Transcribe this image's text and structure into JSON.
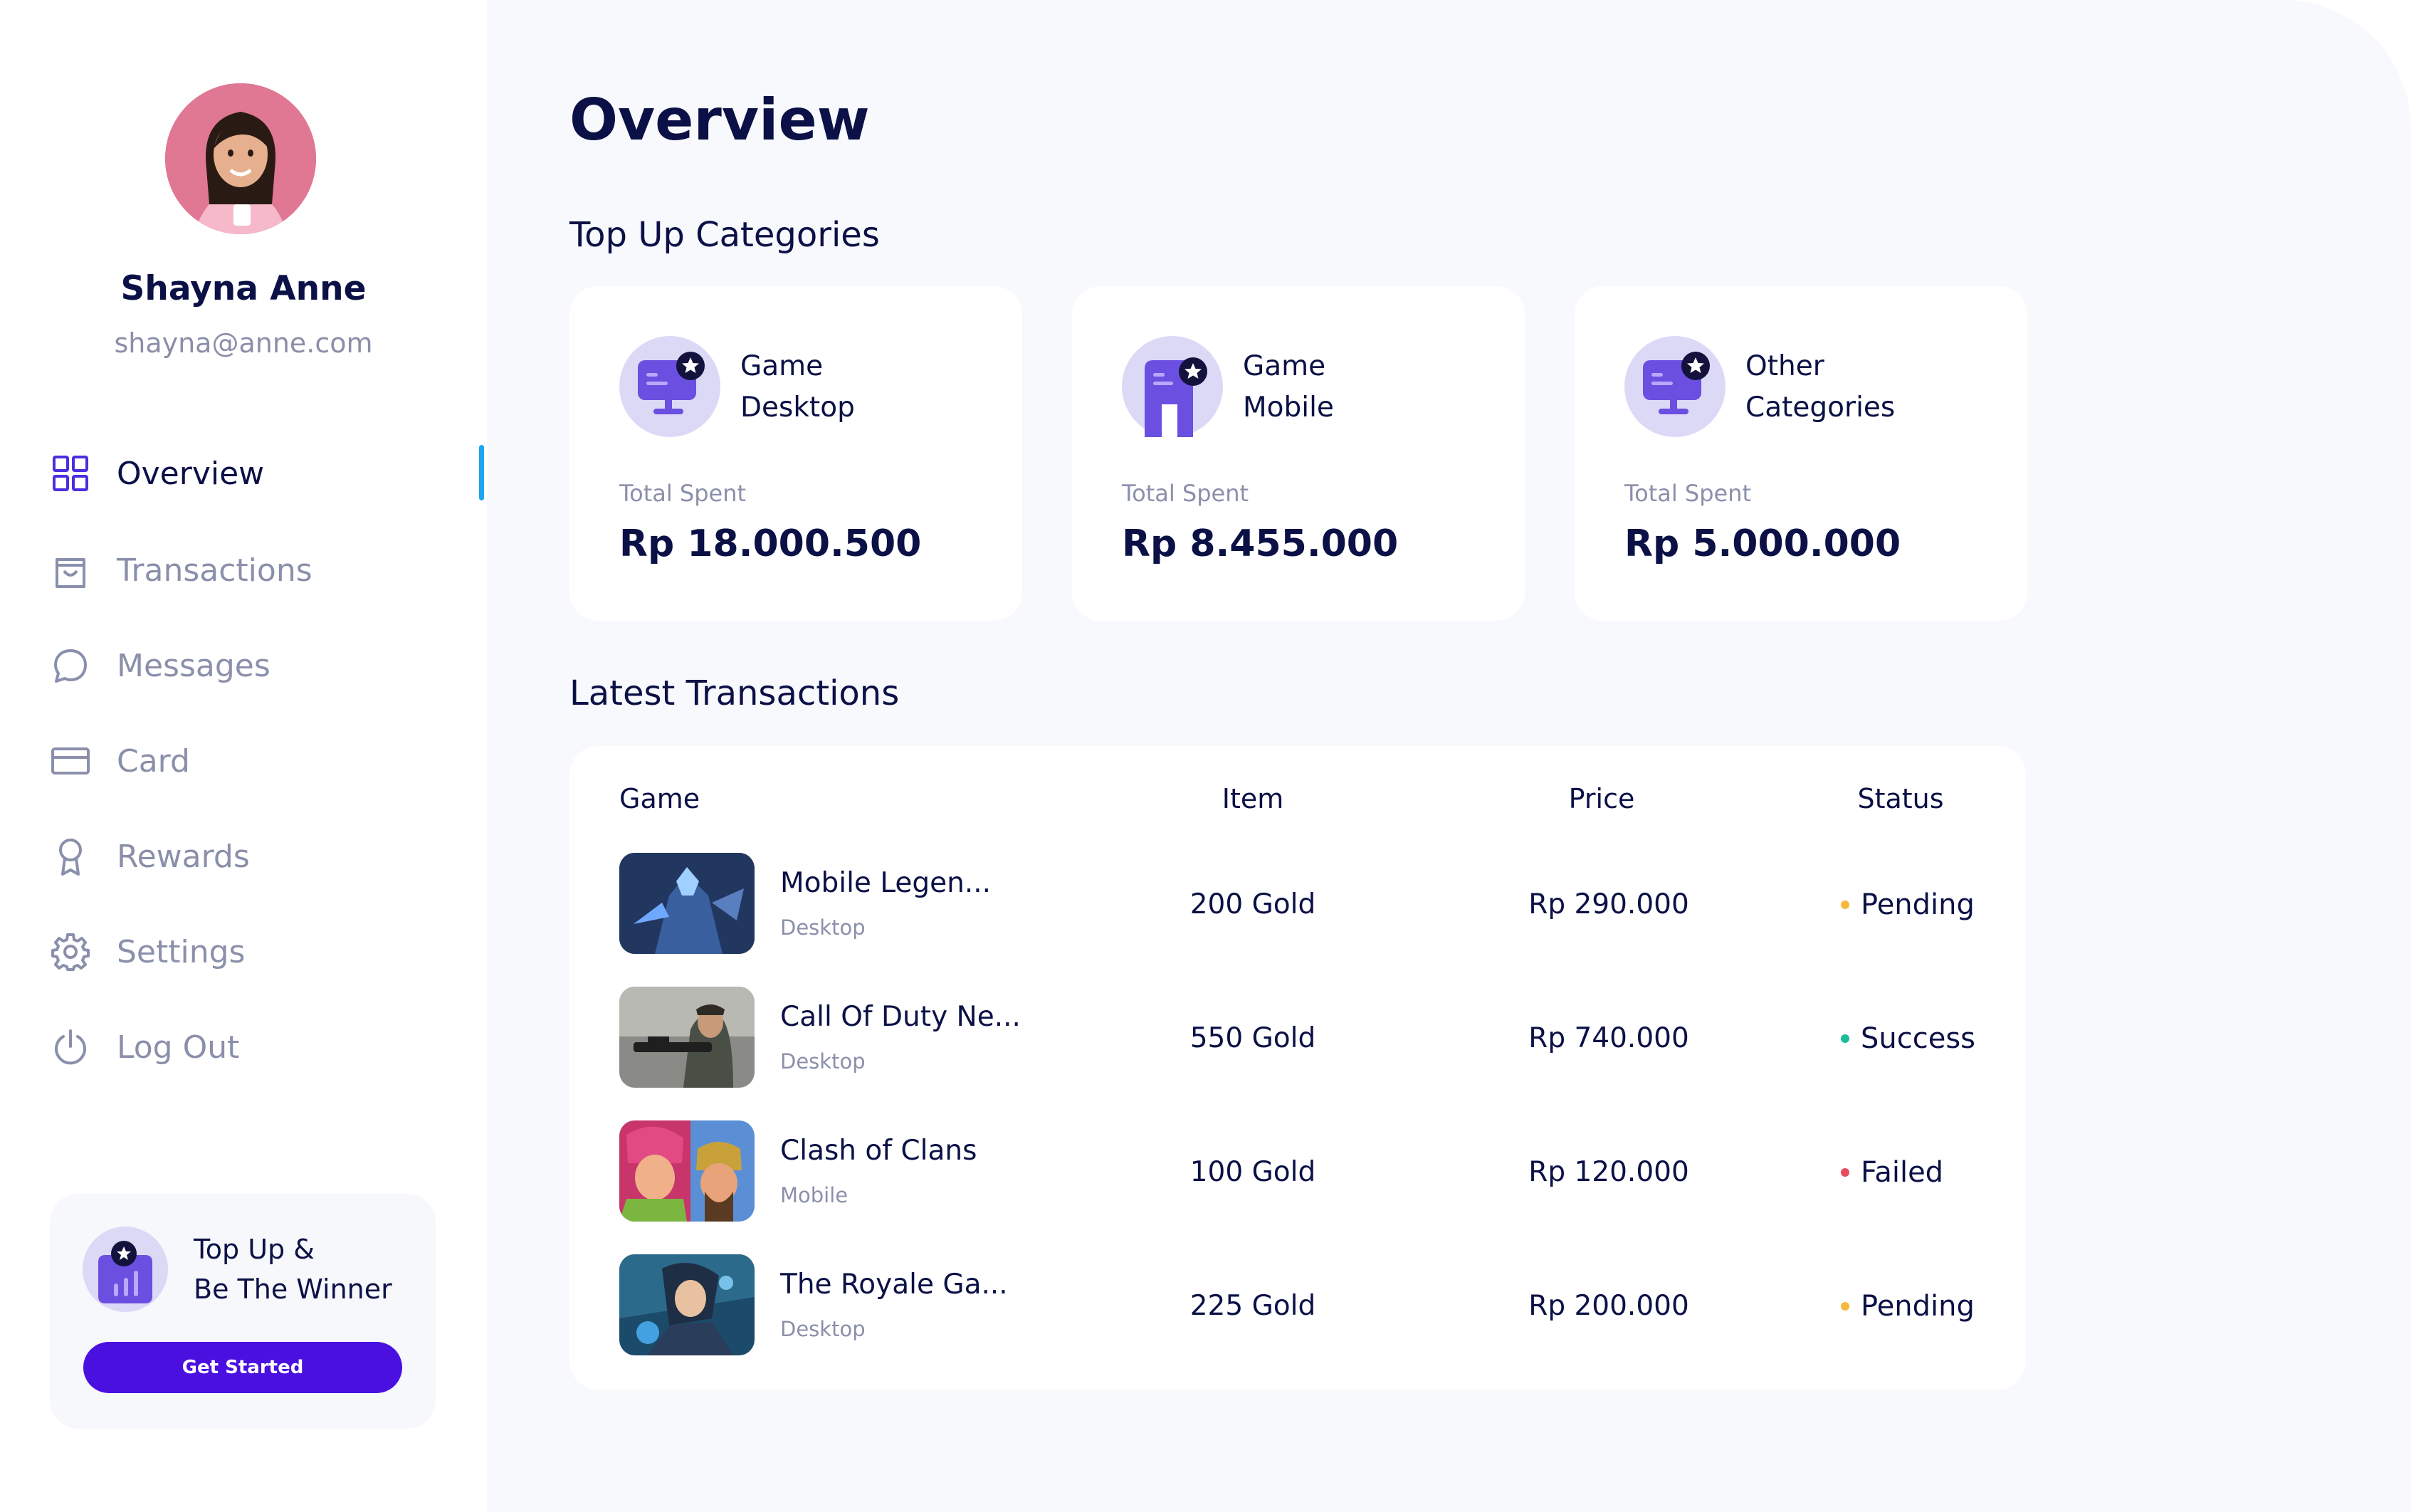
{
  "sidebar": {
    "user": {
      "name": "Shayna Anne",
      "email": "shayna@anne.com"
    },
    "nav": [
      {
        "label": "Overview",
        "icon": "grid-icon",
        "active": true
      },
      {
        "label": "Transactions",
        "icon": "shopping-bag-icon",
        "active": false
      },
      {
        "label": "Messages",
        "icon": "chat-bubble-icon",
        "active": false
      },
      {
        "label": "Card",
        "icon": "credit-card-icon",
        "active": false
      },
      {
        "label": "Rewards",
        "icon": "award-icon",
        "active": false
      },
      {
        "label": "Settings",
        "icon": "gear-icon",
        "active": false
      },
      {
        "label": "Log Out",
        "icon": "power-icon",
        "active": false
      }
    ],
    "promo": {
      "title": "Top Up &\nBe The Winner",
      "button": "Get Started"
    }
  },
  "main": {
    "title": "Overview",
    "categories_title": "Top Up Categories",
    "categories": [
      {
        "name_line1": "Game",
        "name_line2": "Desktop",
        "spent_label": "Total Spent",
        "spent_value": "Rp 18.000.500",
        "icon": "desktop-icon"
      },
      {
        "name_line1": "Game",
        "name_line2": "Mobile",
        "spent_label": "Total Spent",
        "spent_value": "Rp 8.455.000",
        "icon": "mobile-icon"
      },
      {
        "name_line1": "Other",
        "name_line2": "Categories",
        "spent_label": "Total Spent",
        "spent_value": "Rp 5.000.000",
        "icon": "desktop-icon"
      }
    ],
    "transactions_title": "Latest Transactions",
    "table": {
      "headers": {
        "game": "Game",
        "item": "Item",
        "price": "Price",
        "status": "Status"
      },
      "rows": [
        {
          "game": "Mobile Legen...",
          "platform": "Desktop",
          "item": "200 Gold",
          "price": "Rp 290.000",
          "status": "Pending",
          "status_color": "#f6b93b"
        },
        {
          "game": "Call Of Duty Ne...",
          "platform": "Desktop",
          "item": "550 Gold",
          "price": "Rp 740.000",
          "status": "Success",
          "status_color": "#1abc9c"
        },
        {
          "game": "Clash of Clans",
          "platform": "Mobile",
          "item": "100 Gold",
          "price": "Rp 120.000",
          "status": "Failed",
          "status_color": "#e74c5e"
        },
        {
          "game": "The Royale Ga...",
          "platform": "Desktop",
          "item": "225 Gold",
          "price": "Rp 200.000",
          "status": "Pending",
          "status_color": "#f6b93b"
        }
      ]
    }
  },
  "colors": {
    "accent": "#4a10e0",
    "active_indicator": "#1aa6f0",
    "icon_purple": "#6a4fe0",
    "icon_bg": "#dcd9f7",
    "text_dark": "#0b1146",
    "text_muted": "#8a90ab"
  }
}
